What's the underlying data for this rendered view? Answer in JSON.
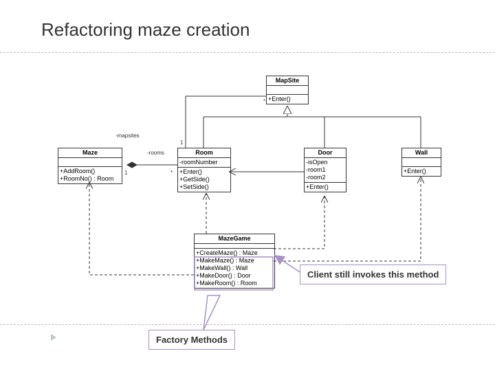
{
  "title": "Refactoring maze creation",
  "classes": {
    "mapsite": {
      "name": "MapSite",
      "ops": [
        "+Enter()"
      ]
    },
    "maze": {
      "name": "Maze",
      "ops": [
        "+AddRoom()",
        "+RoomNo() : Room"
      ]
    },
    "room": {
      "name": "Room",
      "attrs": [
        "-roomNumber"
      ],
      "ops": [
        "+Enter()",
        "+GetSide()",
        "+SetSide()"
      ]
    },
    "door": {
      "name": "Door",
      "attrs": [
        "-isOpen",
        "-room1",
        "-room2"
      ],
      "ops": [
        "+Enter()"
      ]
    },
    "wall": {
      "name": "Wall",
      "ops": [
        "+Enter()"
      ]
    },
    "mazegame": {
      "name": "MazeGame",
      "ops": [
        "+CreateMaze() : Maze",
        "+MakeMaze() : Maze",
        "+MakeWall() : Wall",
        "+MakeDoor() : Door",
        "+MakeRoom() : Room"
      ]
    }
  },
  "labels": {
    "mapsites": "-mapsites",
    "rooms": "-rooms",
    "star1": "*",
    "one_a": "1",
    "one_b": "1",
    "star2": "*"
  },
  "annotations": {
    "note": "Client still invokes this method",
    "callout": "Factory Methods"
  },
  "chart_data": {
    "type": "uml-class-diagram",
    "title": "Refactoring maze creation",
    "classes": [
      {
        "name": "MapSite",
        "attributes": [],
        "operations": [
          "+Enter()"
        ]
      },
      {
        "name": "Maze",
        "attributes": [],
        "operations": [
          "+AddRoom()",
          "+RoomNo() : Room"
        ]
      },
      {
        "name": "Room",
        "attributes": [
          "-roomNumber"
        ],
        "operations": [
          "+Enter()",
          "+GetSide()",
          "+SetSide()"
        ]
      },
      {
        "name": "Door",
        "attributes": [
          "-isOpen",
          "-room1",
          "-room2"
        ],
        "operations": [
          "+Enter()"
        ]
      },
      {
        "name": "Wall",
        "attributes": [],
        "operations": [
          "+Enter()"
        ]
      },
      {
        "name": "MazeGame",
        "attributes": [],
        "operations": [
          "+CreateMaze() : Maze",
          "+MakeMaze() : Maze",
          "+MakeWall() : Wall",
          "+MakeDoor() : Door",
          "+MakeRoom() : Room"
        ]
      }
    ],
    "relations": [
      {
        "from": "Room",
        "to": "MapSite",
        "type": "generalization"
      },
      {
        "from": "Door",
        "to": "MapSite",
        "type": "generalization"
      },
      {
        "from": "Wall",
        "to": "MapSite",
        "type": "generalization"
      },
      {
        "from": "Room",
        "to": "MapSite",
        "type": "association",
        "label": "-mapsites",
        "multiplicity": {
          "Room": "1",
          "MapSite": "*"
        }
      },
      {
        "from": "Maze",
        "to": "Room",
        "type": "composition",
        "label": "-rooms",
        "multiplicity": {
          "Maze": "1",
          "Room": "*"
        }
      },
      {
        "from": "Door",
        "to": "Room",
        "type": "association"
      },
      {
        "from": "MazeGame",
        "to": "Maze",
        "type": "dependency"
      },
      {
        "from": "MazeGame",
        "to": "Room",
        "type": "dependency"
      },
      {
        "from": "MazeGame",
        "to": "Door",
        "type": "dependency"
      },
      {
        "from": "MazeGame",
        "to": "Wall",
        "type": "dependency"
      }
    ],
    "annotations": [
      {
        "text": "Client still invokes this method",
        "points_to": "MazeGame.CreateMaze"
      },
      {
        "text": "Factory Methods",
        "points_to": "MazeGame (MakeMaze/MakeWall/MakeDoor/MakeRoom)"
      }
    ]
  }
}
